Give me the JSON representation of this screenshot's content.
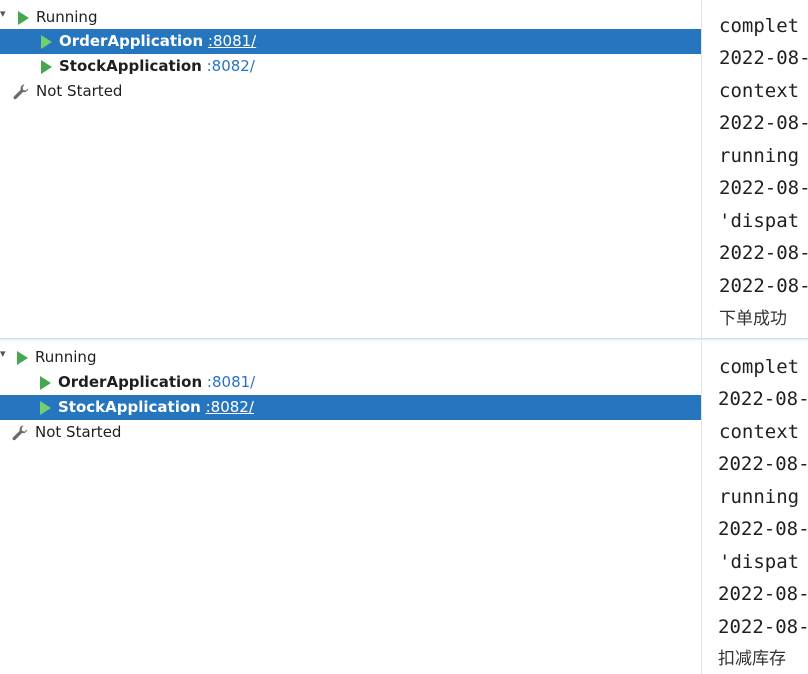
{
  "panels": [
    {
      "tree": {
        "group_label": "Running",
        "apps": [
          {
            "name": "OrderApplication",
            "port": ":8081/",
            "selected": true
          },
          {
            "name": "StockApplication",
            "port": ":8082/",
            "selected": false
          }
        ],
        "not_started_label": "Not Started"
      },
      "console": {
        "lines": [
          "complet",
          "2022-08-",
          "context",
          "2022-08-",
          "running",
          "2022-08-",
          "'dispat",
          "2022-08-",
          "2022-08-",
          "下单成功"
        ]
      }
    },
    {
      "tree": {
        "group_label": "Running",
        "apps": [
          {
            "name": "OrderApplication",
            "port": ":8081/",
            "selected": false
          },
          {
            "name": "StockApplication",
            "port": ":8082/",
            "selected": true
          }
        ],
        "not_started_label": "Not Started"
      },
      "console": {
        "lines": [
          "complet",
          "2022-08-",
          "context",
          "2022-08-",
          "running",
          "2022-08-",
          "'dispat",
          "2022-08-",
          "2022-08-",
          "扣减库存"
        ]
      }
    }
  ],
  "colors": {
    "selection": "#2675bf",
    "play_icon": "#48a550",
    "port_link": "#2b72c4"
  },
  "icons": [
    "play-icon",
    "wrench-icon",
    "chevron-down-icon"
  ]
}
